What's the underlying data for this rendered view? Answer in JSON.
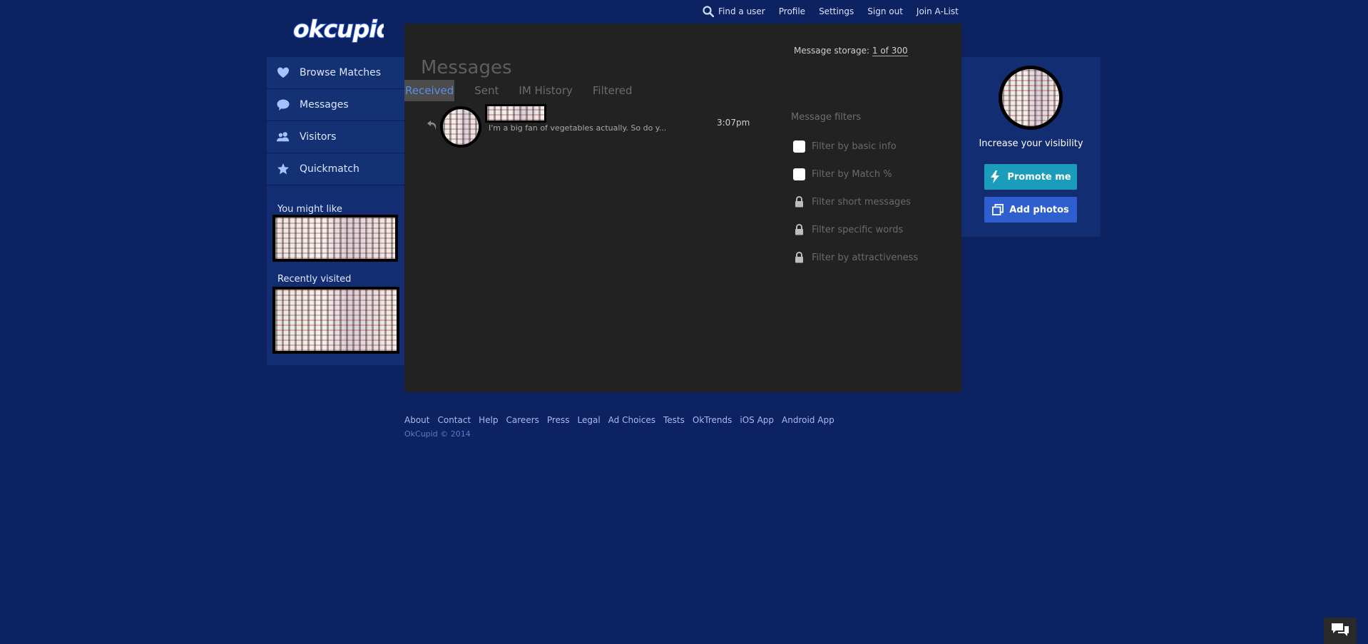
{
  "topnav": {
    "find_user": "Find a user",
    "profile": "Profile",
    "settings": "Settings",
    "sign_out": "Sign out",
    "join_alist": "Join A-List"
  },
  "logo": {
    "text": "okcupid"
  },
  "sidebar": {
    "items": [
      {
        "label": "Browse Matches",
        "icon": "heart-icon"
      },
      {
        "label": "Messages",
        "icon": "speech-bubble-icon"
      },
      {
        "label": "Visitors",
        "icon": "people-icon"
      },
      {
        "label": "Quickmatch",
        "icon": "star-icon"
      }
    ],
    "you_might_like": "You might like",
    "recently_visited": "Recently visited"
  },
  "main": {
    "storage_label": "Message storage:",
    "storage_value": "1 of 300",
    "title": "Messages",
    "tabs": [
      {
        "label": "Received",
        "active": true
      },
      {
        "label": "Sent"
      },
      {
        "label": "IM History"
      },
      {
        "label": "Filtered"
      }
    ],
    "messages": [
      {
        "snippet": "I'm a big fan of vegetables actually. So do y...",
        "time": "3:07pm"
      }
    ],
    "filters": {
      "title": "Message filters",
      "items": [
        {
          "label": "Filter by basic info",
          "type": "checkbox"
        },
        {
          "label": "Filter by Match %",
          "type": "checkbox"
        },
        {
          "label": "Filter short messages",
          "type": "locked"
        },
        {
          "label": "Filter specific words",
          "type": "locked"
        },
        {
          "label": "Filter by attractiveness",
          "type": "locked"
        }
      ]
    }
  },
  "right": {
    "visibility": "Increase your visibility",
    "promote": "Promote me",
    "add_photos": "Add photos"
  },
  "footer": {
    "links": [
      "About",
      "Contact",
      "Help",
      "Careers",
      "Press",
      "Legal",
      "Ad Choices",
      "Tests",
      "OkTrends",
      "iOS App",
      "Android App"
    ],
    "copyright": "OkCupid © 2014"
  },
  "colors": {
    "background": "#0d2260",
    "panel": "#222222",
    "sidebar": "#132d72",
    "active_tab": "#5a8ee8",
    "promote": "#1a9dbb",
    "add_photos": "#2f5fce"
  }
}
